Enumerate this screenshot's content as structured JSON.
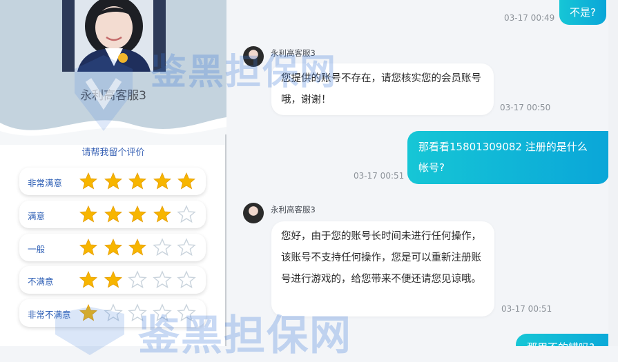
{
  "agent": {
    "name": "永利高客服3"
  },
  "rating": {
    "title": "请帮我留个评价",
    "options": [
      {
        "label": "非常满意",
        "stars": 5
      },
      {
        "label": "满意",
        "stars": 4
      },
      {
        "label": "一般",
        "stars": 3
      },
      {
        "label": "不满意",
        "stars": 2
      },
      {
        "label": "非常不满意",
        "stars": 1
      }
    ],
    "max_stars": 5
  },
  "messages": [
    {
      "text": "不是?",
      "time": "03-17 00:49"
    },
    {
      "sender": "永利高客服3",
      "text": "您提供的账号不存在，请您核实您的会员账号哦，谢谢！",
      "time": "03-17 00:50"
    },
    {
      "text": "那看看15801309082 注册的是什么 帐号?",
      "time": "03-17 00:51"
    },
    {
      "sender": "永利高客服3",
      "text": "您好，由于您的账号长时间未进行任何操作，该账号不支持任何操作，您是可以重新注册账号进行游戏的，给您带来不便还请您见谅哦。",
      "time": "03-17 00:51"
    },
    {
      "text": "那用不的错吗?"
    }
  ],
  "watermark": {
    "text": "鉴黑担保网"
  },
  "colors": {
    "star_filled": "#f7b500",
    "star_empty": "#c9d3dc",
    "accent": "#2e5fb5",
    "outgoing": "#0aa6d8"
  },
  "icons": {
    "star": "star-icon",
    "avatar": "agent-avatar"
  }
}
